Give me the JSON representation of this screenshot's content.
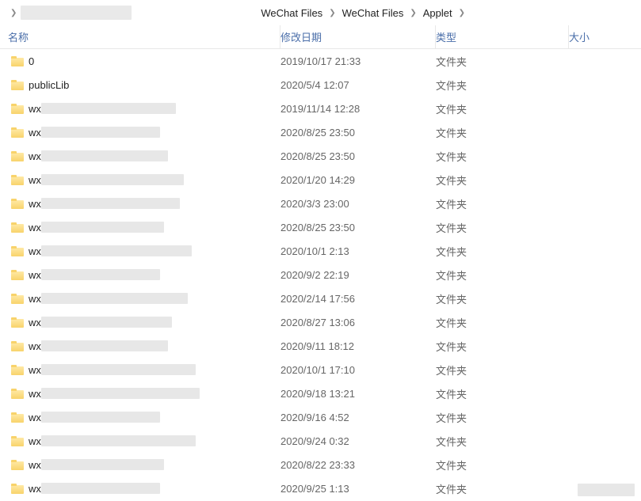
{
  "breadcrumb": {
    "items": [
      {
        "label": "WeChat Files"
      },
      {
        "label": "WeChat Files"
      },
      {
        "label": "Applet"
      }
    ]
  },
  "headers": {
    "name": "名称",
    "date": "修改日期",
    "type": "类型",
    "size": "大小"
  },
  "type_folder": "文件夹",
  "rows": [
    {
      "name": "0",
      "redacted": false,
      "redact_w": 0,
      "date": "2019/10/17 21:33"
    },
    {
      "name": "publicLib",
      "redacted": false,
      "redact_w": 0,
      "date": "2020/5/4 12:07"
    },
    {
      "name": "wx",
      "redacted": true,
      "redact_w": 170,
      "date": "2019/11/14 12:28"
    },
    {
      "name": "wx",
      "redacted": true,
      "redact_w": 150,
      "date": "2020/8/25 23:50"
    },
    {
      "name": "wx",
      "redacted": true,
      "redact_w": 160,
      "date": "2020/8/25 23:50"
    },
    {
      "name": "wx",
      "redacted": true,
      "redact_w": 180,
      "date": "2020/1/20 14:29"
    },
    {
      "name": "wx",
      "redacted": true,
      "redact_w": 175,
      "date": "2020/3/3 23:00"
    },
    {
      "name": "wx",
      "redacted": true,
      "redact_w": 155,
      "date": "2020/8/25 23:50"
    },
    {
      "name": "wx",
      "redacted": true,
      "redact_w": 190,
      "date": "2020/10/1 2:13"
    },
    {
      "name": "wx",
      "redacted": true,
      "redact_w": 150,
      "date": "2020/9/2 22:19"
    },
    {
      "name": "wx",
      "redacted": true,
      "redact_w": 185,
      "date": "2020/2/14 17:56"
    },
    {
      "name": "wx",
      "redacted": true,
      "redact_w": 165,
      "date": "2020/8/27 13:06"
    },
    {
      "name": "wx",
      "redacted": true,
      "redact_w": 160,
      "date": "2020/9/11 18:12"
    },
    {
      "name": "wx",
      "redacted": true,
      "redact_w": 195,
      "date": "2020/10/1 17:10"
    },
    {
      "name": "wx",
      "redacted": true,
      "redact_w": 200,
      "date": "2020/9/18 13:21"
    },
    {
      "name": "wx",
      "redacted": true,
      "redact_w": 150,
      "date": "2020/9/16 4:52"
    },
    {
      "name": "wx",
      "redacted": true,
      "redact_w": 195,
      "date": "2020/9/24 0:32"
    },
    {
      "name": "wx",
      "redacted": true,
      "redact_w": 155,
      "date": "2020/8/22 23:33"
    },
    {
      "name": "wx",
      "redacted": true,
      "redact_w": 150,
      "date": "2020/9/25 1:13"
    }
  ]
}
